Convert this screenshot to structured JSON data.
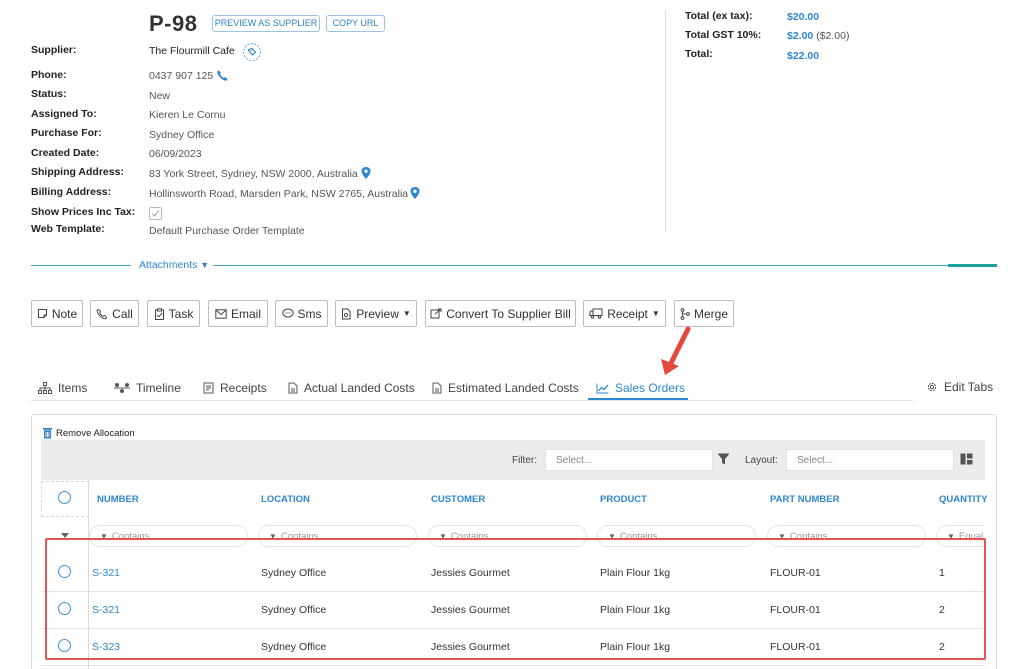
{
  "header": {
    "po_number": "P-98",
    "preview_as_supplier": "PREVIEW AS SUPPLIER",
    "copy_url": "COPY URL"
  },
  "details": [
    {
      "label": "Supplier:",
      "value": "The Flourmill Cafe",
      "icon": "tag-icon"
    },
    {
      "label": "Phone:",
      "value": "0437 907 125",
      "icon": "phone-icon"
    },
    {
      "label": "Status:",
      "value": "New"
    },
    {
      "label": "Assigned To:",
      "value": "Kieren Le Cornu"
    },
    {
      "label": "Purchase For:",
      "value": "Sydney Office"
    },
    {
      "label": "Created Date:",
      "value": "06/09/2023"
    },
    {
      "label": "Shipping Address:",
      "value": "83 York Street, Sydney, NSW 2000, Australia",
      "icon": "map-pin-icon"
    },
    {
      "label": "Billing Address:",
      "value": "Hollinsworth Road, Marsden Park, NSW 2765, Australia",
      "icon": "map-pin-icon"
    },
    {
      "label": "Show Prices Inc Tax:",
      "value_checked": true
    },
    {
      "label": "Web Template:",
      "value": "Default Purchase Order Template"
    }
  ],
  "totals": [
    {
      "label": "Total (ex tax):",
      "value": "$20.00",
      "sub": ""
    },
    {
      "label": "Total GST 10%:",
      "value": "$2.00",
      "sub": "($2.00)"
    },
    {
      "label": "Total:",
      "value": "$22.00",
      "sub": ""
    }
  ],
  "attachments_label": "Attachments",
  "toolbar": {
    "note": "Note",
    "call": "Call",
    "task": "Task",
    "email": "Email",
    "sms": "Sms",
    "preview": "Preview",
    "convert": "Convert To Supplier Bill",
    "receipt": "Receipt",
    "merge": "Merge"
  },
  "tabs": {
    "items": "Items",
    "timeline": "Timeline",
    "receipts": "Receipts",
    "actual_landed_costs": "Actual Landed Costs",
    "estimated_landed_costs": "Estimated Landed Costs",
    "sales_orders": "Sales Orders",
    "edit_tabs": "Edit Tabs",
    "active": "sales_orders"
  },
  "grid": {
    "remove_allocation": "Remove Allocation",
    "filter_label": "Filter:",
    "filter_placeholder": "Select...",
    "layout_label": "Layout:",
    "layout_placeholder": "Select...",
    "columns": [
      "NUMBER",
      "LOCATION",
      "CUSTOMER",
      "PRODUCT",
      "PART NUMBER",
      "QUANTITY"
    ],
    "filters": [
      "Contains",
      "Contains",
      "Contains",
      "Contains",
      "Contains",
      "Equal"
    ],
    "rows": [
      {
        "number": "S-321",
        "location": "Sydney Office",
        "customer": "Jessies Gourmet",
        "product": "Plain Flour 1kg",
        "part_number": "FLOUR-01",
        "quantity": "1"
      },
      {
        "number": "S-321",
        "location": "Sydney Office",
        "customer": "Jessies Gourmet",
        "product": "Plain Flour 1kg",
        "part_number": "FLOUR-01",
        "quantity": "2"
      },
      {
        "number": "S-323",
        "location": "Sydney Office",
        "customer": "Jessies Gourmet",
        "product": "Plain Flour 1kg",
        "part_number": "FLOUR-01",
        "quantity": "2"
      }
    ]
  },
  "colors": {
    "accent": "#2f87d1",
    "highlight": "#e55353",
    "teal": "#1aa39a"
  }
}
